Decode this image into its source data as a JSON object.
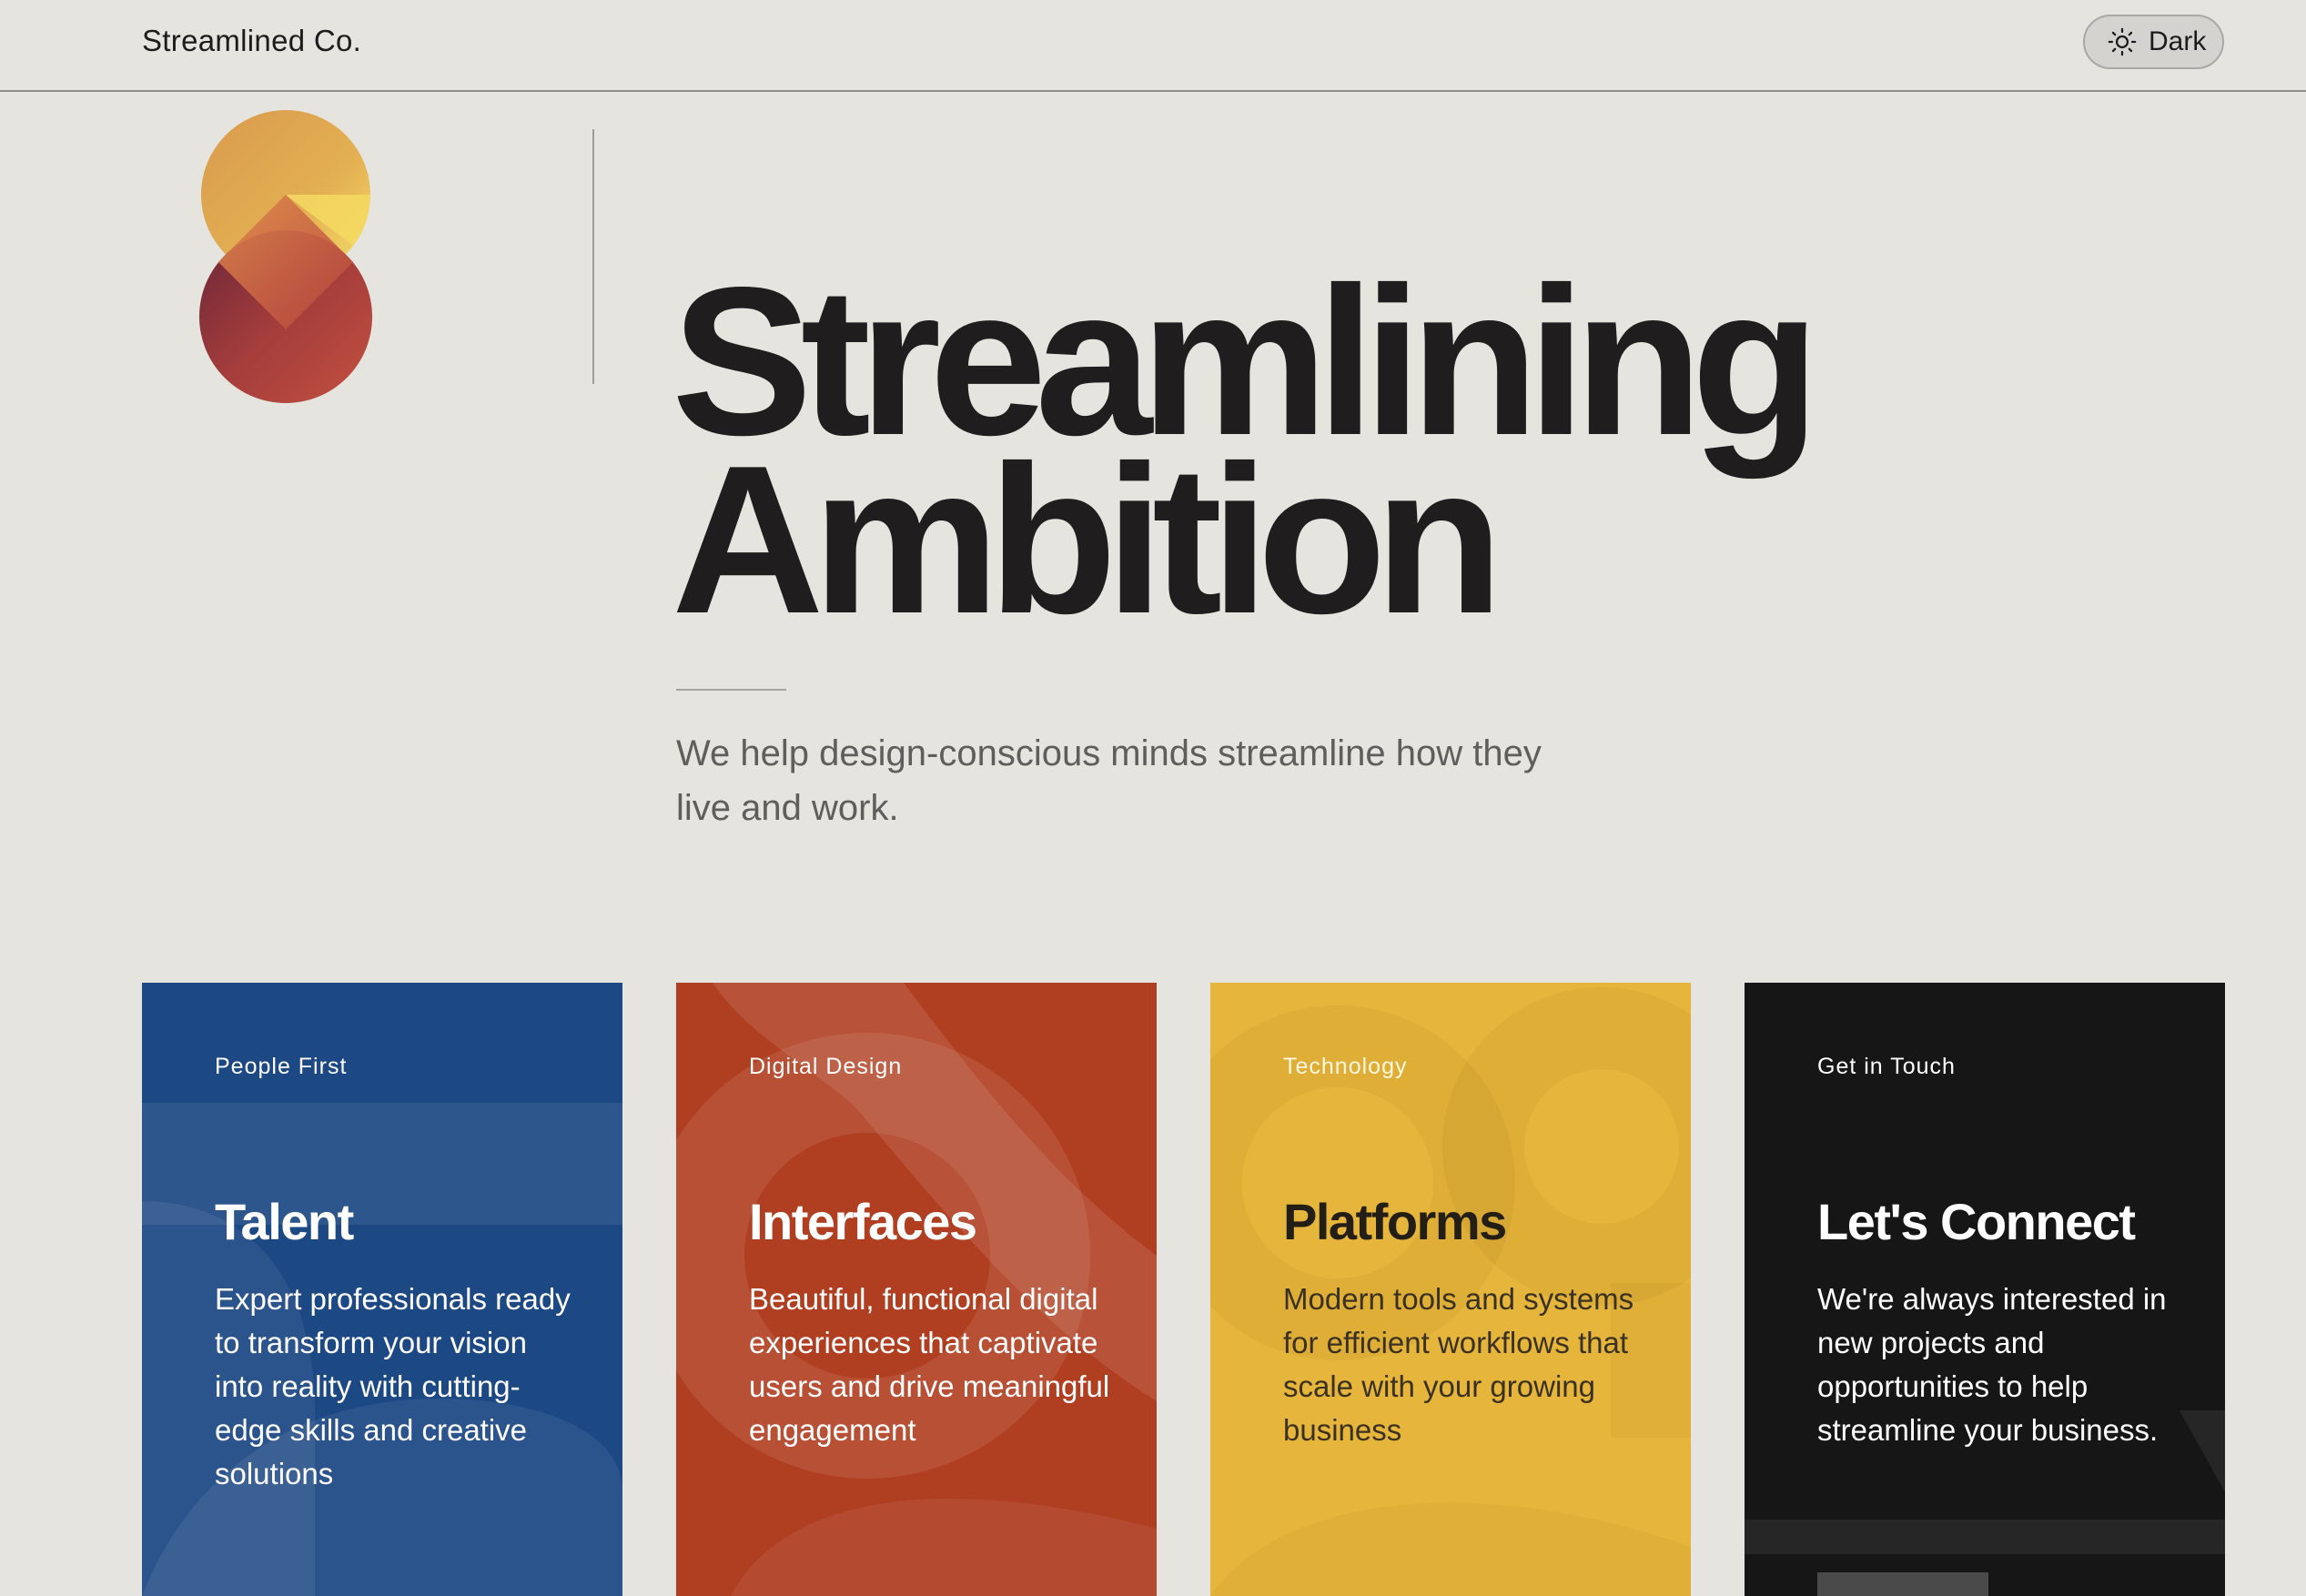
{
  "header": {
    "brand": "Streamlined Co.",
    "theme_toggle_label": "Dark",
    "theme_toggle_icon": "sun-icon"
  },
  "hero": {
    "headline_line1": "Streamlining",
    "headline_line2": "Ambition",
    "tagline": "We help design-conscious minds streamline how they live and work.",
    "logo_colors": [
      "#f2d35e",
      "#d98b4a",
      "#b8453d",
      "#6d2838"
    ]
  },
  "cards": [
    {
      "eyebrow": "People First",
      "title": "Talent",
      "text": "Expert professionals ready to transform your vision into reality with cutting-edge skills and creative solutions",
      "color": "#1c4884"
    },
    {
      "eyebrow": "Digital Design",
      "title": "Interfaces",
      "text": "Beautiful, functional digital experiences that captivate users and drive meaningful engagement",
      "color": "#b03f22"
    },
    {
      "eyebrow": "Technology",
      "title": "Platforms",
      "text": "Modern tools and systems for efficient workflows that scale with your growing business",
      "color": "#e6b53b"
    },
    {
      "eyebrow": "Get in Touch",
      "title": "Let's Connect",
      "text": "We're always interested in new projects and opportunities to help streamline your business.",
      "color": "#161616"
    }
  ]
}
